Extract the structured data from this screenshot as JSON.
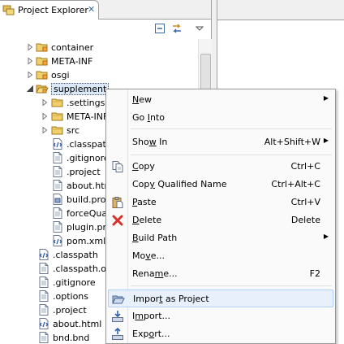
{
  "explorer": {
    "tab_title": "Project Explorer",
    "tab_close": "✕"
  },
  "tree": [
    {
      "label": "container",
      "kind": "folder-pkg",
      "expanded": false
    },
    {
      "label": "META-INF",
      "kind": "folder-pkg",
      "expanded": false
    },
    {
      "label": "osgi",
      "kind": "folder-pkg",
      "expanded": false
    },
    {
      "label": "supplement",
      "kind": "folder-pkg-open",
      "expanded": true,
      "selected": true
    },
    {
      "label": ".settings",
      "kind": "folder",
      "expanded": false
    },
    {
      "label": "META-INF",
      "kind": "folder",
      "expanded": false
    },
    {
      "label": "src",
      "kind": "folder",
      "expanded": false
    },
    {
      "label": ".classpath",
      "kind": "xml"
    },
    {
      "label": ".gitignore",
      "kind": "file"
    },
    {
      "label": ".project",
      "kind": "file"
    },
    {
      "label": "about.html",
      "kind": "file"
    },
    {
      "label": "build.properties",
      "kind": "props"
    },
    {
      "label": "forceQualifierUpdate.txt",
      "kind": "file"
    },
    {
      "label": "plugin.properties",
      "kind": "file"
    },
    {
      "label": "pom.xml",
      "kind": "xml"
    },
    {
      "label": ".classpath",
      "kind": "xml"
    },
    {
      "label": ".classpath.osgi",
      "kind": "file"
    },
    {
      "label": ".gitignore",
      "kind": "file"
    },
    {
      "label": ".options",
      "kind": "file"
    },
    {
      "label": ".project",
      "kind": "file"
    },
    {
      "label": "about.html",
      "kind": "xml"
    },
    {
      "label": "bnd.bnd",
      "kind": "file"
    }
  ],
  "menu": {
    "items": [
      {
        "pre": "",
        "mn": "N",
        "post": "ew",
        "key": "",
        "sub": true,
        "icon": ""
      },
      {
        "pre": "Go ",
        "mn": "I",
        "post": "nto",
        "key": "",
        "sub": false,
        "icon": ""
      },
      {
        "sep": true
      },
      {
        "pre": "Sho",
        "mn": "w",
        "post": " In",
        "key": "Alt+Shift+W",
        "sub": true,
        "icon": ""
      },
      {
        "sep": true
      },
      {
        "pre": "",
        "mn": "C",
        "post": "opy",
        "key": "Ctrl+C",
        "sub": false,
        "icon": "copy-icon"
      },
      {
        "pre": "Cop",
        "mn": "y",
        "post": " Qualified Name",
        "key": "Ctrl+Alt+C",
        "sub": false,
        "icon": ""
      },
      {
        "pre": "",
        "mn": "P",
        "post": "aste",
        "key": "Ctrl+V",
        "sub": false,
        "icon": "paste-icon"
      },
      {
        "pre": "",
        "mn": "D",
        "post": "elete",
        "key": "Delete",
        "sub": false,
        "icon": "delete-icon"
      },
      {
        "pre": "",
        "mn": "B",
        "post": "uild Path",
        "key": "",
        "sub": true,
        "icon": ""
      },
      {
        "pre": "Mo",
        "mn": "v",
        "post": "e...",
        "key": "",
        "sub": false,
        "icon": ""
      },
      {
        "pre": "Rena",
        "mn": "m",
        "post": "e...",
        "key": "F2",
        "sub": false,
        "icon": ""
      },
      {
        "sep": true
      },
      {
        "pre": "Impor",
        "mn": "t",
        "post": " as Project",
        "key": "",
        "sub": false,
        "icon": "open-folder-icon",
        "highlight": true
      },
      {
        "pre": "I",
        "mn": "m",
        "post": "port...",
        "key": "",
        "sub": false,
        "icon": "import-icon"
      },
      {
        "pre": "Exp",
        "mn": "o",
        "post": "rt...",
        "key": "",
        "sub": false,
        "icon": "export-icon"
      }
    ]
  }
}
